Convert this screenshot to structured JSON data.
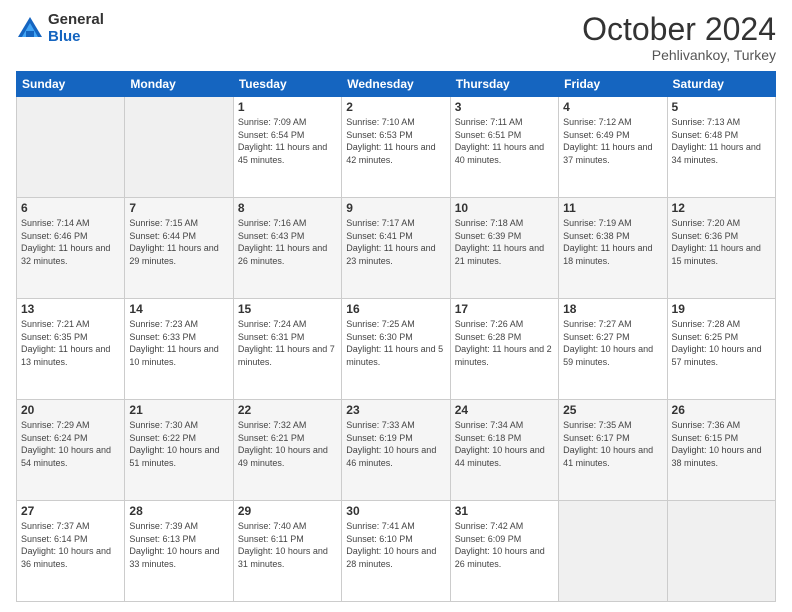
{
  "logo": {
    "general": "General",
    "blue": "Blue"
  },
  "title": "October 2024",
  "subtitle": "Pehlivankoy, Turkey",
  "days_header": [
    "Sunday",
    "Monday",
    "Tuesday",
    "Wednesday",
    "Thursday",
    "Friday",
    "Saturday"
  ],
  "weeks": [
    [
      {
        "day": "",
        "sunrise": "",
        "sunset": "",
        "daylight": ""
      },
      {
        "day": "",
        "sunrise": "",
        "sunset": "",
        "daylight": ""
      },
      {
        "day": "1",
        "sunrise": "Sunrise: 7:09 AM",
        "sunset": "Sunset: 6:54 PM",
        "daylight": "Daylight: 11 hours and 45 minutes."
      },
      {
        "day": "2",
        "sunrise": "Sunrise: 7:10 AM",
        "sunset": "Sunset: 6:53 PM",
        "daylight": "Daylight: 11 hours and 42 minutes."
      },
      {
        "day": "3",
        "sunrise": "Sunrise: 7:11 AM",
        "sunset": "Sunset: 6:51 PM",
        "daylight": "Daylight: 11 hours and 40 minutes."
      },
      {
        "day": "4",
        "sunrise": "Sunrise: 7:12 AM",
        "sunset": "Sunset: 6:49 PM",
        "daylight": "Daylight: 11 hours and 37 minutes."
      },
      {
        "day": "5",
        "sunrise": "Sunrise: 7:13 AM",
        "sunset": "Sunset: 6:48 PM",
        "daylight": "Daylight: 11 hours and 34 minutes."
      }
    ],
    [
      {
        "day": "6",
        "sunrise": "Sunrise: 7:14 AM",
        "sunset": "Sunset: 6:46 PM",
        "daylight": "Daylight: 11 hours and 32 minutes."
      },
      {
        "day": "7",
        "sunrise": "Sunrise: 7:15 AM",
        "sunset": "Sunset: 6:44 PM",
        "daylight": "Daylight: 11 hours and 29 minutes."
      },
      {
        "day": "8",
        "sunrise": "Sunrise: 7:16 AM",
        "sunset": "Sunset: 6:43 PM",
        "daylight": "Daylight: 11 hours and 26 minutes."
      },
      {
        "day": "9",
        "sunrise": "Sunrise: 7:17 AM",
        "sunset": "Sunset: 6:41 PM",
        "daylight": "Daylight: 11 hours and 23 minutes."
      },
      {
        "day": "10",
        "sunrise": "Sunrise: 7:18 AM",
        "sunset": "Sunset: 6:39 PM",
        "daylight": "Daylight: 11 hours and 21 minutes."
      },
      {
        "day": "11",
        "sunrise": "Sunrise: 7:19 AM",
        "sunset": "Sunset: 6:38 PM",
        "daylight": "Daylight: 11 hours and 18 minutes."
      },
      {
        "day": "12",
        "sunrise": "Sunrise: 7:20 AM",
        "sunset": "Sunset: 6:36 PM",
        "daylight": "Daylight: 11 hours and 15 minutes."
      }
    ],
    [
      {
        "day": "13",
        "sunrise": "Sunrise: 7:21 AM",
        "sunset": "Sunset: 6:35 PM",
        "daylight": "Daylight: 11 hours and 13 minutes."
      },
      {
        "day": "14",
        "sunrise": "Sunrise: 7:23 AM",
        "sunset": "Sunset: 6:33 PM",
        "daylight": "Daylight: 11 hours and 10 minutes."
      },
      {
        "day": "15",
        "sunrise": "Sunrise: 7:24 AM",
        "sunset": "Sunset: 6:31 PM",
        "daylight": "Daylight: 11 hours and 7 minutes."
      },
      {
        "day": "16",
        "sunrise": "Sunrise: 7:25 AM",
        "sunset": "Sunset: 6:30 PM",
        "daylight": "Daylight: 11 hours and 5 minutes."
      },
      {
        "day": "17",
        "sunrise": "Sunrise: 7:26 AM",
        "sunset": "Sunset: 6:28 PM",
        "daylight": "Daylight: 11 hours and 2 minutes."
      },
      {
        "day": "18",
        "sunrise": "Sunrise: 7:27 AM",
        "sunset": "Sunset: 6:27 PM",
        "daylight": "Daylight: 10 hours and 59 minutes."
      },
      {
        "day": "19",
        "sunrise": "Sunrise: 7:28 AM",
        "sunset": "Sunset: 6:25 PM",
        "daylight": "Daylight: 10 hours and 57 minutes."
      }
    ],
    [
      {
        "day": "20",
        "sunrise": "Sunrise: 7:29 AM",
        "sunset": "Sunset: 6:24 PM",
        "daylight": "Daylight: 10 hours and 54 minutes."
      },
      {
        "day": "21",
        "sunrise": "Sunrise: 7:30 AM",
        "sunset": "Sunset: 6:22 PM",
        "daylight": "Daylight: 10 hours and 51 minutes."
      },
      {
        "day": "22",
        "sunrise": "Sunrise: 7:32 AM",
        "sunset": "Sunset: 6:21 PM",
        "daylight": "Daylight: 10 hours and 49 minutes."
      },
      {
        "day": "23",
        "sunrise": "Sunrise: 7:33 AM",
        "sunset": "Sunset: 6:19 PM",
        "daylight": "Daylight: 10 hours and 46 minutes."
      },
      {
        "day": "24",
        "sunrise": "Sunrise: 7:34 AM",
        "sunset": "Sunset: 6:18 PM",
        "daylight": "Daylight: 10 hours and 44 minutes."
      },
      {
        "day": "25",
        "sunrise": "Sunrise: 7:35 AM",
        "sunset": "Sunset: 6:17 PM",
        "daylight": "Daylight: 10 hours and 41 minutes."
      },
      {
        "day": "26",
        "sunrise": "Sunrise: 7:36 AM",
        "sunset": "Sunset: 6:15 PM",
        "daylight": "Daylight: 10 hours and 38 minutes."
      }
    ],
    [
      {
        "day": "27",
        "sunrise": "Sunrise: 7:37 AM",
        "sunset": "Sunset: 6:14 PM",
        "daylight": "Daylight: 10 hours and 36 minutes."
      },
      {
        "day": "28",
        "sunrise": "Sunrise: 7:39 AM",
        "sunset": "Sunset: 6:13 PM",
        "daylight": "Daylight: 10 hours and 33 minutes."
      },
      {
        "day": "29",
        "sunrise": "Sunrise: 7:40 AM",
        "sunset": "Sunset: 6:11 PM",
        "daylight": "Daylight: 10 hours and 31 minutes."
      },
      {
        "day": "30",
        "sunrise": "Sunrise: 7:41 AM",
        "sunset": "Sunset: 6:10 PM",
        "daylight": "Daylight: 10 hours and 28 minutes."
      },
      {
        "day": "31",
        "sunrise": "Sunrise: 7:42 AM",
        "sunset": "Sunset: 6:09 PM",
        "daylight": "Daylight: 10 hours and 26 minutes."
      },
      {
        "day": "",
        "sunrise": "",
        "sunset": "",
        "daylight": ""
      },
      {
        "day": "",
        "sunrise": "",
        "sunset": "",
        "daylight": ""
      }
    ]
  ]
}
